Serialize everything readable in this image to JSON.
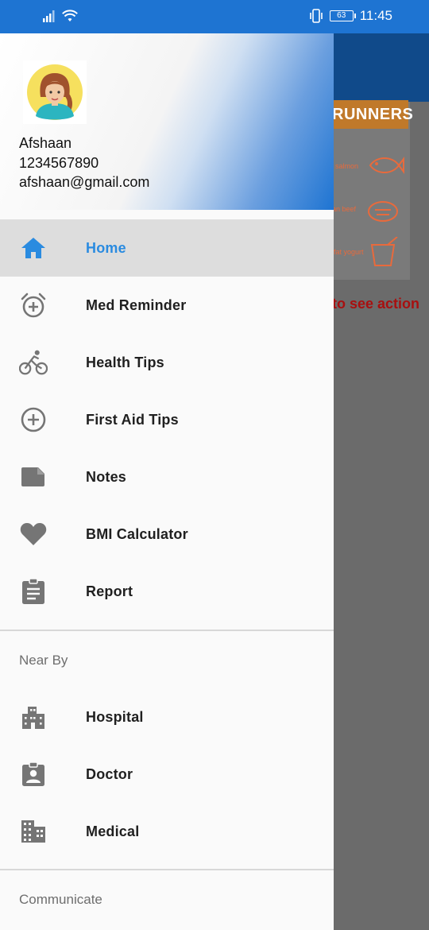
{
  "status_bar": {
    "battery": "63",
    "time": "11:45",
    "color": "#1e74d2"
  },
  "background": {
    "banner": "RUNNERS",
    "foods": [
      "salmon",
      "an beef",
      "fat yogurt"
    ],
    "action_hint": "to see action",
    "hint_color": "#a80f0f"
  },
  "drawer": {
    "user": {
      "name": "Afshaan",
      "phone": "1234567890",
      "email": "afshaan@gmail.com"
    },
    "menu": [
      {
        "label": "Home",
        "icon": "home-icon",
        "selected": true
      },
      {
        "label": "Med Reminder",
        "icon": "alarm-add-icon"
      },
      {
        "label": "Health Tips",
        "icon": "bike-icon"
      },
      {
        "label": "First Aid Tips",
        "icon": "add-circle-icon"
      },
      {
        "label": "Notes",
        "icon": "note-icon"
      },
      {
        "label": "BMI Calculator",
        "icon": "heart-icon"
      },
      {
        "label": "Report",
        "icon": "clipboard-icon"
      }
    ],
    "near_by": {
      "title": "Near By",
      "items": [
        {
          "label": "Hospital",
          "icon": "hospital-building-icon"
        },
        {
          "label": "Doctor",
          "icon": "doctor-badge-icon"
        },
        {
          "label": "Medical",
          "icon": "medical-building-icon"
        }
      ]
    },
    "communicate": {
      "title": "Communicate"
    },
    "accent_color": "#2a8be0",
    "icon_color": "#757575"
  }
}
